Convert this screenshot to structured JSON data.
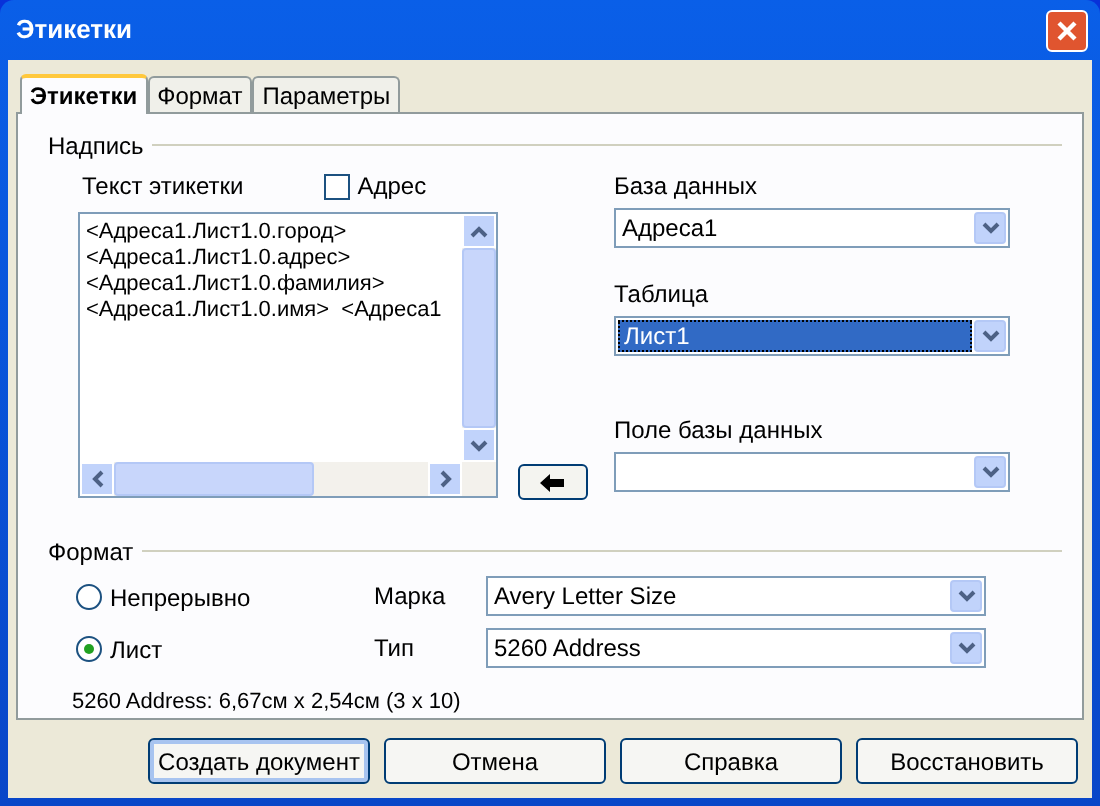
{
  "window": {
    "title": "Этикетки"
  },
  "tabs": [
    {
      "label": "Этикетки",
      "selected": true
    },
    {
      "label": "Формат",
      "selected": false
    },
    {
      "label": "Параметры",
      "selected": false
    }
  ],
  "inscription": {
    "group_label": "Надпись",
    "text_label": "Текст этикетки",
    "address_checkbox": {
      "label": "Адрес",
      "checked": false
    },
    "text_lines": [
      "<Адреса1.Лист1.0.город>",
      "<Адреса1.Лист1.0.адрес>",
      "<Адреса1.Лист1.0.фамилия>",
      "<Адреса1.Лист1.0.имя>  <Адреса1"
    ],
    "database": {
      "label": "База данных",
      "value": "Адреса1",
      "highlighted": false
    },
    "table": {
      "label": "Таблица",
      "value": "Лист1",
      "highlighted": true
    },
    "field": {
      "label": "Поле базы данных",
      "highlighted": false
    }
  },
  "format": {
    "group_label": "Формат",
    "radios": [
      {
        "label": "Непрерывно",
        "selected": false
      },
      {
        "label": "Лист",
        "selected": true
      }
    ],
    "brand": {
      "label": "Марка",
      "value": "Avery Letter Size"
    },
    "type": {
      "label": "Тип",
      "value": "5260 Address"
    },
    "info": "5260 Address: 6,67см x 2,54см (3 x 10)"
  },
  "buttons": [
    {
      "label": "Создать документ",
      "default": true
    },
    {
      "label": "Отмена",
      "default": false
    },
    {
      "label": "Справка",
      "default": false
    },
    {
      "label": "Восстановить",
      "default": false
    }
  ]
}
